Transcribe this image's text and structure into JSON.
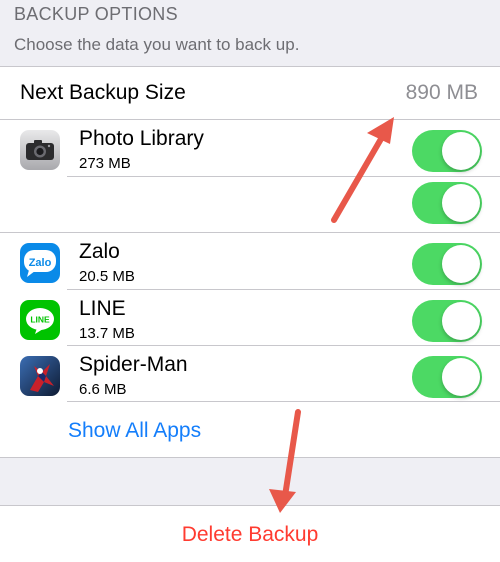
{
  "header": {
    "title": "BACKUP OPTIONS",
    "subtitle": "Choose the data you want to back up."
  },
  "backup_size": {
    "label": "Next Backup Size",
    "value": "890 MB"
  },
  "apps": [
    {
      "name": "Photo Library",
      "size": "273 MB",
      "icon": "camera-icon",
      "enabled": true
    },
    {
      "name": "",
      "size": "",
      "icon": "",
      "enabled": true
    },
    {
      "name": "Zalo",
      "size": "20.5 MB",
      "icon": "zalo-app-icon",
      "icon_text": "Zalo",
      "enabled": true
    },
    {
      "name": "LINE",
      "size": "13.7 MB",
      "icon": "line-app-icon",
      "icon_text": "LINE",
      "enabled": true
    },
    {
      "name": "Spider-Man",
      "size": "6.6 MB",
      "icon": "spider-man-app-icon",
      "enabled": true
    }
  ],
  "show_all_label": "Show All Apps",
  "delete_label": "Delete Backup",
  "colors": {
    "toggle_on": "#4cd964",
    "link": "#147efb",
    "destructive": "#ff3b30",
    "annotation_arrow": "#e8584a"
  }
}
